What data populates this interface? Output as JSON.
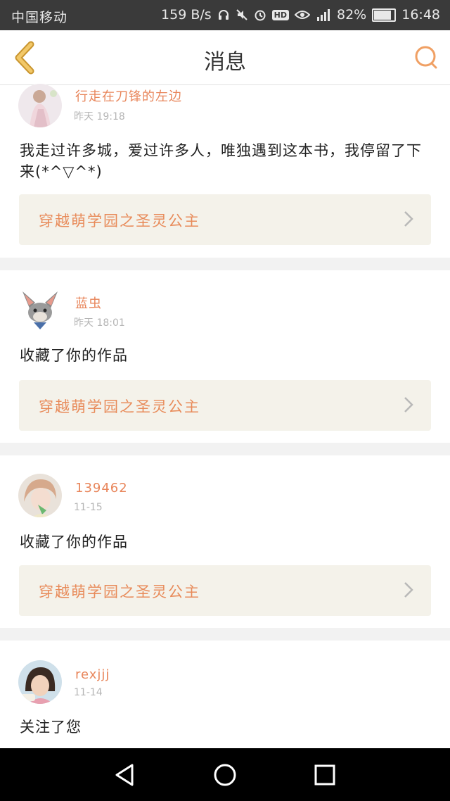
{
  "status": {
    "carrier": "中国移动",
    "speed": "159 B/s",
    "battery": "82%",
    "time": "16:48"
  },
  "header": {
    "title": "消息"
  },
  "messages": [
    {
      "user": "行走在刀锋的左边",
      "time": "昨天 19:18",
      "text": "我走过许多城，爱过许多人，唯独遇到这本书，我停留了下来(*^▽^*)",
      "book": "穿越萌学园之圣灵公主"
    },
    {
      "user": "蓝虫",
      "time": "昨天 18:01",
      "text": "收藏了你的作品",
      "book": "穿越萌学园之圣灵公主"
    },
    {
      "user": "139462",
      "time": "11-15",
      "text": "收藏了你的作品",
      "book": "穿越萌学园之圣灵公主"
    },
    {
      "user": "rexjjj",
      "time": "11-14",
      "text": "关注了您"
    }
  ],
  "colors": {
    "accent": "#e8855a",
    "back_arrow": "#e8b34a",
    "card_bg": "#f4f2ea"
  },
  "icons": [
    "back-arrow-icon",
    "search-icon",
    "chevron-right-icon",
    "nav-back-icon",
    "nav-home-icon",
    "nav-recent-icon"
  ]
}
